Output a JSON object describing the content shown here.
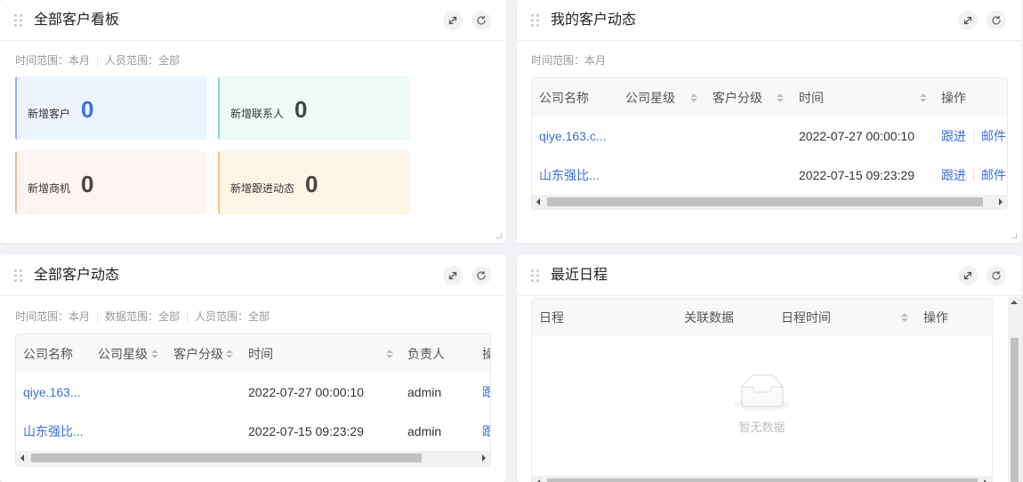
{
  "theme": {
    "page_background": "#f0f2f5",
    "card_background": "#ffffff",
    "link_color": "#3b6ee0",
    "table_header_background": "#f7f8fa",
    "scrollbar_thumb": "#c1c1c1"
  },
  "icons": {
    "drag_handle": "drag-handle-icon",
    "expand": "expand-icon",
    "refresh": "refresh-icon",
    "sort": "sort-icon",
    "empty": "empty-inbox-icon"
  },
  "overview": {
    "title": "全部客户看板",
    "filters": [
      "时间范围：本月",
      "人员范围：全部"
    ],
    "stats": [
      {
        "label": "新增客户",
        "value": "0",
        "background": "#edf4ff",
        "accent": "#8db2f6",
        "value_color": "#3a6ff7"
      },
      {
        "label": "新增联系人",
        "value": "0",
        "background": "#eefaf5",
        "accent": "#93d8bf",
        "value_color": "#444444"
      },
      {
        "label": "新增商机",
        "value": "0",
        "background": "#fff4f1",
        "accent": "#f2b7a3",
        "value_color": "#444444"
      },
      {
        "label": "新增跟进动态",
        "value": "0",
        "background": "#fff5e6",
        "accent": "#f3c46e",
        "value_color": "#444444"
      }
    ]
  },
  "my_activity": {
    "title": "我的客户动态",
    "filters": [
      "时间范围：本月"
    ],
    "columns": [
      {
        "label": "公司名称",
        "sortable": false
      },
      {
        "label": "公司星级",
        "sortable": true
      },
      {
        "label": "客户分级",
        "sortable": true
      },
      {
        "label": "时间",
        "sortable": true
      },
      {
        "label": "操作",
        "sortable": false
      }
    ],
    "rows": [
      {
        "company": "qiye.163.c...",
        "time": "2022-07-27 00:00:10",
        "actions": [
          "跟进",
          "邮件"
        ]
      },
      {
        "company": "山东强比...",
        "time": "2022-07-15 09:23:29",
        "actions": [
          "跟进",
          "邮件"
        ]
      }
    ]
  },
  "all_activity": {
    "title": "全部客户动态",
    "filters": [
      "时间范围：本月",
      "数据范围：全部",
      "人员范围：全部"
    ],
    "columns": [
      {
        "label": "公司名称",
        "sortable": false
      },
      {
        "label": "公司星级",
        "sortable": true
      },
      {
        "label": "客户分级",
        "sortable": true
      },
      {
        "label": "时间",
        "sortable": true
      },
      {
        "label": "负责人",
        "sortable": false
      },
      {
        "label": "操",
        "sortable": false
      }
    ],
    "rows": [
      {
        "company": "qiye.163...",
        "time": "2022-07-27 00:00:10",
        "owner": "admin",
        "action": "跟"
      },
      {
        "company": "山东强比...",
        "time": "2022-07-15 09:23:29",
        "owner": "admin",
        "action": "跟"
      }
    ]
  },
  "schedule": {
    "title": "最近日程",
    "columns": [
      {
        "label": "日程",
        "sortable": false
      },
      {
        "label": "关联数据",
        "sortable": false
      },
      {
        "label": "日程时间",
        "sortable": true
      },
      {
        "label": "操作",
        "sortable": false
      }
    ],
    "empty_text": "暂无数据"
  }
}
